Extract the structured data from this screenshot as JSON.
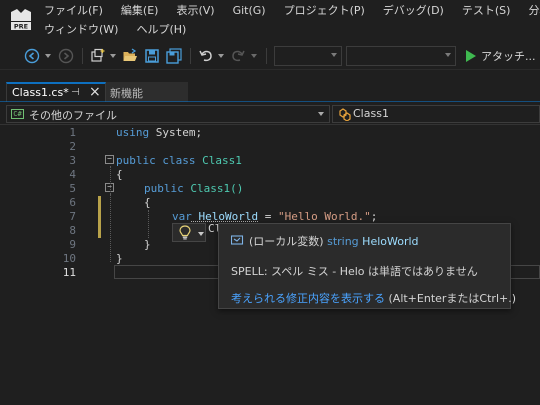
{
  "menu": {
    "row1": [
      "ファイル(F)",
      "編集(E)",
      "表示(V)",
      "Git(G)",
      "プロジェクト(P)",
      "デバッグ(D)",
      "テスト(S)",
      "分析(N)"
    ],
    "row2": [
      "ウィンドウ(W)",
      "ヘルプ(H)"
    ]
  },
  "logo": {
    "badge": "PRE"
  },
  "toolbar": {
    "attach_label": "アタッチ...",
    "icons": [
      "back-icon",
      "forward-icon",
      "new-project-icon",
      "open-folder-icon",
      "save-icon",
      "save-all-icon",
      "undo-icon",
      "redo-icon",
      "play-icon"
    ]
  },
  "tabs": [
    {
      "label": "Class1.cs*",
      "active": true
    },
    {
      "label": "新機能",
      "active": false
    }
  ],
  "navbar": {
    "scope": "その他のファイル",
    "scope_badge": "C#",
    "member": "Class1"
  },
  "editor": {
    "line_numbers": [
      "1",
      "2",
      "3",
      "4",
      "5",
      "6",
      "7",
      "8",
      "9",
      "10",
      "11"
    ],
    "current_line": "11",
    "lines": {
      "l1_kw": "using",
      "l1_rest": " System;",
      "l3_kw": "public class",
      "l3_type": " Class1",
      "l4": "{",
      "l5_kw": "public",
      "l5_rest": " Class1()",
      "l6": "{",
      "l7_kw": "var",
      "l7_var": " HeloWorld",
      "l7_eq": " = ",
      "l7_str": "\"Hello World.\"",
      "l7_end": ";",
      "l8_partial": "Cl",
      "l9": "}",
      "l10": "}"
    }
  },
  "tooltip": {
    "line1_prefix": "(ローカル変数)",
    "line1_type": " string",
    "line1_name": " HeloWorld",
    "line2": "SPELL: スペル ミス - Helo は単語ではありません",
    "line3_link": "考えられる修正内容を表示する",
    "line3_hint": " (Alt+EnterまたはCtrl+.)"
  },
  "colors": {
    "accent": "#0e70c0",
    "keyword": "#569cd6",
    "type": "#4ec9b0",
    "string": "#d69d85",
    "link": "#4aa3ff",
    "play": "#3fb950"
  }
}
